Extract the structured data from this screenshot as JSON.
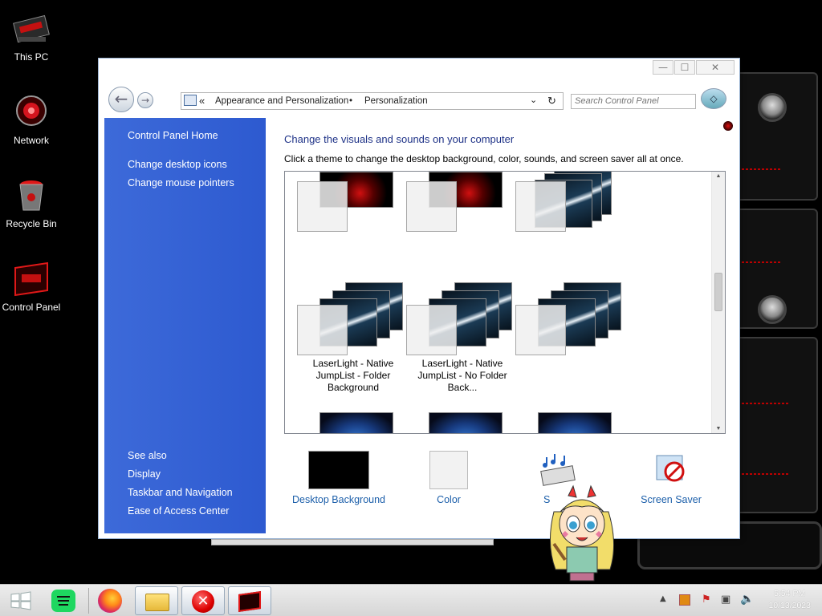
{
  "desktop": {
    "icons": [
      {
        "label": "This PC"
      },
      {
        "label": "Network"
      },
      {
        "label": "Recycle Bin"
      },
      {
        "label": "Control Panel"
      }
    ]
  },
  "window": {
    "controls": {
      "minimize": "—",
      "maximize": "☐",
      "close": "✕"
    },
    "address": {
      "chevrons": "«",
      "crumb1": "Appearance and Personalization",
      "separator": "•",
      "crumb2": "Personalization"
    },
    "search_placeholder": "Search Control Panel"
  },
  "sidebar": {
    "home": "Control Panel Home",
    "links": [
      "Change desktop icons",
      "Change mouse pointers"
    ],
    "see_also_title": "See also",
    "see_also": [
      "Display",
      "Taskbar and Navigation",
      "Ease of Access Center"
    ]
  },
  "content": {
    "heading": "Change the visuals and sounds on your computer",
    "subheading": "Click a theme to change the desktop background, color, sounds, and screen saver all at once.",
    "themes_row2": [
      {
        "name": "LaserLight - Native JumpList - Folder Background"
      },
      {
        "name": "LaserLight - Native JumpList - No Folder Back..."
      },
      {
        "name": ""
      }
    ]
  },
  "bottom": {
    "desktop_background": "Desktop Background",
    "color": "Color",
    "sounds": "S",
    "screen_saver": "Screen Saver"
  },
  "taskbar": {
    "time": "5:54 PM",
    "date": "10/13/2023"
  },
  "colors": {
    "sidebar_blue": "#3d6ad9",
    "heading_blue": "#1e3287",
    "link_blue": "#1c5faa",
    "alienware_red": "#c41010"
  }
}
